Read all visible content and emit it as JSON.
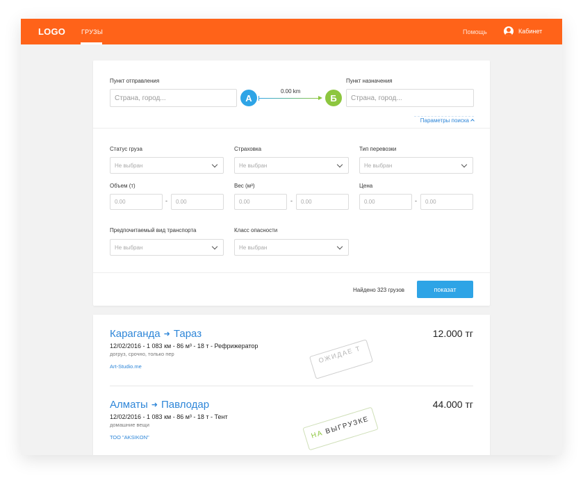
{
  "header": {
    "logo": "LOGO",
    "nav_cargo": "ГРУЗЫ",
    "help": "Помощь",
    "cabinet": "Кабинет"
  },
  "search": {
    "from_label": "Пункт отправления",
    "from_placeholder": "Страна, город...",
    "to_label": "Пункт назначения",
    "to_placeholder": "Страна, город...",
    "pin_a": "A",
    "pin_b": "Б",
    "distance": "0.00 km",
    "params_link": "Параметры поиска"
  },
  "filters": {
    "status_label": "Статус груза",
    "status_value": "Не выбран",
    "insurance_label": "Страховка",
    "insurance_value": "Не выбран",
    "transport_type_label": "Тип перевозки",
    "transport_type_value": "Не выбран",
    "volume_label": "Объем (т)",
    "volume_from": "0.00",
    "volume_to": "0.00",
    "weight_label": "Вес (м³)",
    "weight_from": "0.00",
    "weight_to": "0.00",
    "price_label": "Цена",
    "price_from": "0.00",
    "price_to": "0.00",
    "range_sep": "-",
    "preferred_transport_label": "Предпочитаемый вид транспорта",
    "preferred_transport_value": "Не выбран",
    "danger_class_label": "Класс опасности",
    "danger_class_value": "Не выбран"
  },
  "results": {
    "found_text": "Найдено 323 грузов",
    "show_button": "показат"
  },
  "cargo_list": [
    {
      "from": "Караганда",
      "to": "Тараз",
      "meta": "12/02/2016 - 1 083 км - 86 м³ - 18 т - Рефрижератор",
      "note": "догруз, срочно, только пер",
      "company": "Art-Studio.me",
      "price": "12.000 тг",
      "stamp": "ОЖИДАЕ Т"
    },
    {
      "from": "Алматы",
      "to": "Павлодар",
      "meta": "12/02/2016 - 1 083 км - 86 м³ - 18 т - Тент",
      "note": "домашние вещи",
      "company": "ТОО \"AKSIKON\"",
      "price": "44.000 тг",
      "stamp_green": "НА",
      "stamp_rest": "ВЫГРУЗКЕ"
    }
  ],
  "colors": {
    "header": "#ff6319",
    "accent_blue": "#2ea4e6",
    "accent_green": "#8dc63f",
    "link_blue": "#2e86d8"
  }
}
